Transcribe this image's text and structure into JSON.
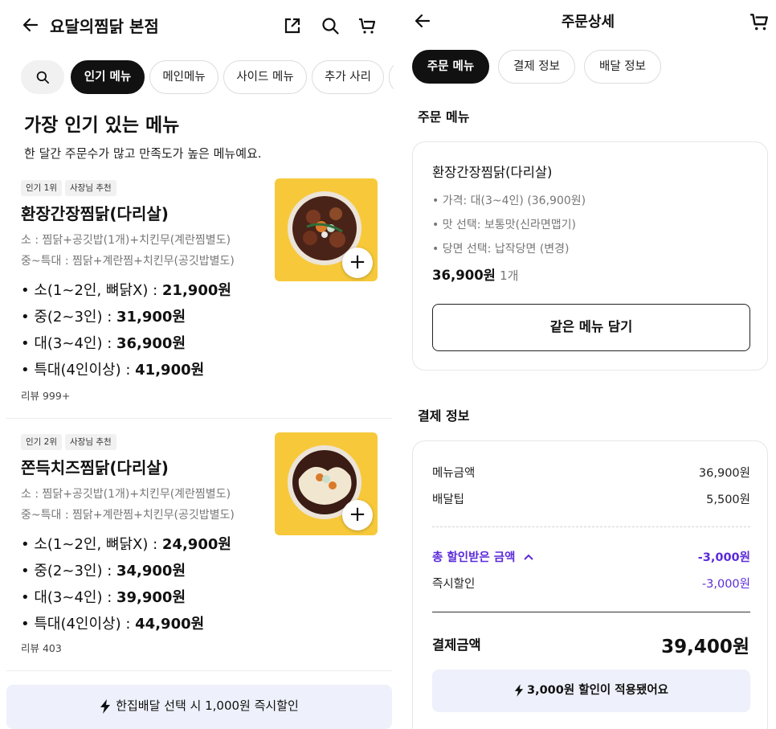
{
  "store": {
    "title": "요달의찜닭 본점",
    "header_icons": [
      "back-arrow-icon",
      "share-icon",
      "search-icon",
      "cart-icon"
    ]
  },
  "categories": {
    "search_icon": "search-icon",
    "items": [
      "인기 메뉴",
      "메인메뉴",
      "사이드 메뉴",
      "추가 사리"
    ],
    "active_index": 0
  },
  "popular": {
    "title": "가장 인기 있는 메뉴",
    "subtitle": "한 달간 주문수가 많고 만족도가 높은 메뉴예요."
  },
  "menu_items": [
    {
      "badges": [
        "인기 1위",
        "사장님 추천"
      ],
      "name": "환장간장찜닭(다리살)",
      "desc": [
        "소 : 찜닭+공깃밥(1개)+치킨무(계란찜별도)",
        "중~특대 : 찜닭+계란찜+치킨무(공깃밥별도)"
      ],
      "prices": [
        {
          "label": "• 소(1~2인, 뼈닭X) : ",
          "value": "21,900원"
        },
        {
          "label": "• 중(2~3인) : ",
          "value": "31,900원"
        },
        {
          "label": "• 대(3~4인) : ",
          "value": "36,900원"
        },
        {
          "label": "• 특대(4인이상) : ",
          "value": "41,900원"
        }
      ],
      "review": "리뷰 999+"
    },
    {
      "badges": [
        "인기 2위",
        "사장님 추천"
      ],
      "name": "쫀득치즈찜닭(다리살)",
      "desc": [
        "소 : 찜닭+공깃밥(1개)+치킨무(계란찜별도)",
        "중~특대 : 찜닭+계란찜+치킨무(공깃밥별도)"
      ],
      "prices": [
        {
          "label": "• 소(1~2인, 뼈닭X) : ",
          "value": "24,900원"
        },
        {
          "label": "• 중(2~3인) : ",
          "value": "34,900원"
        },
        {
          "label": "• 대(3~4인) : ",
          "value": "39,900원"
        },
        {
          "label": "• 특대(4인이상) : ",
          "value": "44,900원"
        }
      ],
      "review": "리뷰 403"
    }
  ],
  "promo_banner": {
    "icon": "lightning-icon",
    "text": "한집배달 선택 시 1,000원 즉시할인"
  },
  "order": {
    "title": "주문상세",
    "tabs": [
      "주문 메뉴",
      "결제 정보",
      "배달 정보"
    ],
    "active_tab": 0,
    "menu_section_title": "주문 메뉴",
    "item": {
      "name": "환장간장찜닭(다리살)",
      "options": [
        "• 가격: 대(3~4인) (36,900원)",
        "• 맛 선택: 보통맛(신라면맵기)",
        "• 당면 선택: 납작당면 (변경)"
      ],
      "price": "36,900원",
      "qty": "1개"
    },
    "same_menu_button": "같은 메뉴 담기",
    "payment_section_title": "결제 정보",
    "payment": {
      "menu_amount_label": "메뉴금액",
      "menu_amount": "36,900원",
      "delivery_tip_label": "배달팁",
      "delivery_tip": "5,500원",
      "discount_label": "총 할인받은 금액",
      "discount_total": "-3,000원",
      "instant_label": "즉시할인",
      "instant": "-3,000원",
      "total_label": "결제금액",
      "total": "39,400원",
      "applied_text": "3,000원 할인이 적용됐어요"
    }
  },
  "colors": {
    "accent": "#5b2bd9",
    "thumb_bg": "#f7c93a",
    "banner_bg": "#eef1fb"
  }
}
